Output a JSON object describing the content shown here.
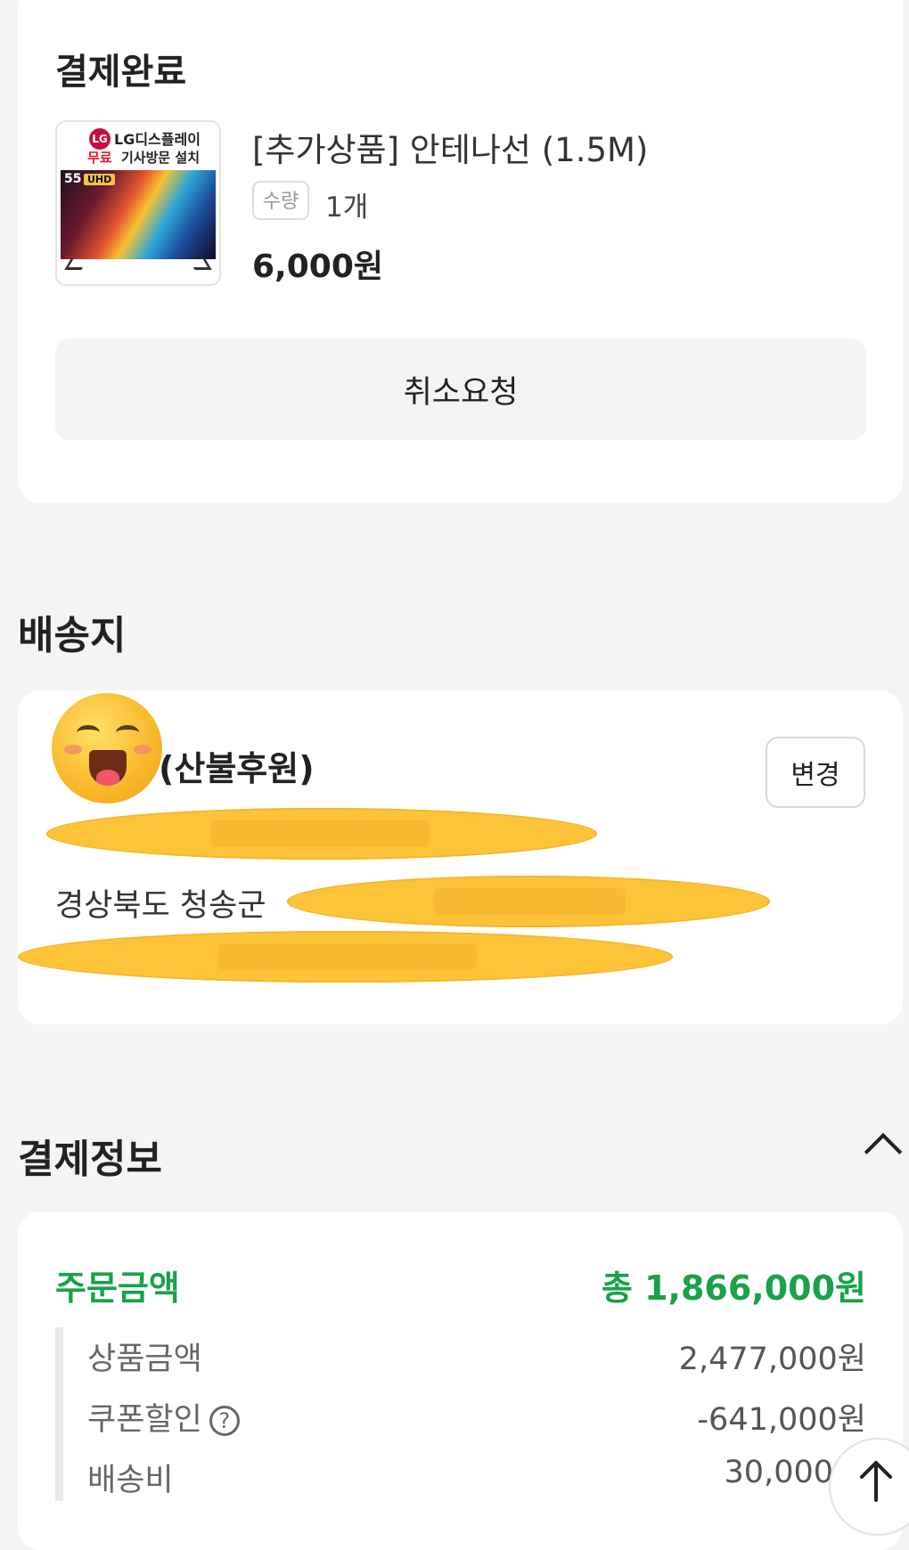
{
  "order": {
    "status_title": "결제완료",
    "product": {
      "thumbnail": {
        "brand_logo": "LG",
        "brand_text": "LG디스플레이",
        "free_text": "무료",
        "visit_text": "기사방문 설치",
        "size_text": "55",
        "badge_text": "UHD"
      },
      "name": "[추가상품] 안테나선 (1.5M)",
      "qty_label": "수량",
      "qty_value": "1개",
      "price": "6,000원"
    },
    "cancel_label": "취소요청"
  },
  "shipping": {
    "title": "배송지",
    "recipient": "(산불후원)",
    "change_label": "변경",
    "address": "경상북도 청송군",
    "redaction_icon": "smiling-emoji-icon"
  },
  "payment": {
    "title": "결제정보",
    "toggle_icon": "chevron-up-icon",
    "order_amount_label": "주문금액",
    "order_amount_value": "총 1,866,000원",
    "accent_color": "#1aa14a",
    "rows": [
      {
        "label": "상품금액",
        "value": "2,477,000원"
      },
      {
        "label": "쿠폰할인",
        "value": "-641,000원",
        "help_icon": "question-icon"
      },
      {
        "label": "배송비",
        "value": "30,000"
      }
    ]
  },
  "scroll_top_icon": "arrow-up-icon"
}
